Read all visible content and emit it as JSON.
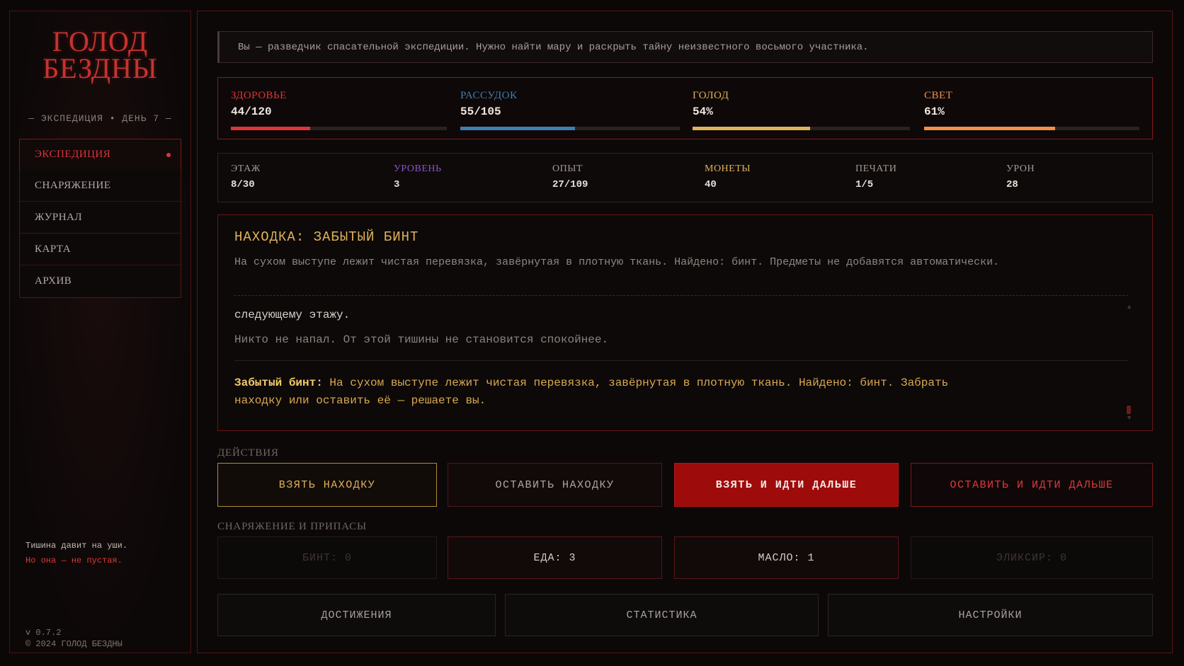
{
  "sidebar": {
    "title_line1": "ГОЛОД",
    "title_line2": "БЕЗДНЫ",
    "day_line": "— ЭКСПЕДИЦИЯ • ДЕНЬ 7 —",
    "nav": [
      {
        "label": "ЭКСПЕДИЦИЯ",
        "active": true
      },
      {
        "label": "СНАРЯЖЕНИЕ"
      },
      {
        "label": "ЖУРНАЛ"
      },
      {
        "label": "КАРТА"
      },
      {
        "label": "АРХИВ"
      }
    ],
    "flavor_line1": "Тишина давит на уши.",
    "flavor_line2": "Но она — не пустая.",
    "version": "v 0.7.2",
    "copyright": "© 2024 ГОЛОД БЕЗДНЫ"
  },
  "intro": "Вы — разведчик спасательной экспедиции. Нужно найти мару и раскрыть тайну неизвестного восьмого участника.",
  "vitals": [
    {
      "label": "ЗДОРОВЬЕ",
      "value": "44/120",
      "fraction": 0.367,
      "color": "#e0343a"
    },
    {
      "label": "РАССУДОК",
      "value": "55/105",
      "fraction": 0.524,
      "color": "#3e7fb0"
    },
    {
      "label": "ГОЛОД",
      "value": "54%",
      "fraction": 0.54,
      "color": "#e0b25a"
    },
    {
      "label": "СВЕТ",
      "value": "61%",
      "fraction": 0.61,
      "color": "#f0904a"
    }
  ],
  "stats": [
    {
      "label": "ЭТАЖ",
      "value": "8/30",
      "color": "#a39890"
    },
    {
      "label": "УРОВЕНЬ",
      "value": "3",
      "color": "#8a55c8"
    },
    {
      "label": "ОПЫТ",
      "value": "27/109",
      "color": "#a39890"
    },
    {
      "label": "МОНЕТЫ",
      "value": "40",
      "color": "#e0b25a"
    },
    {
      "label": "ПЕЧАТИ",
      "value": "1/5",
      "color": "#a39890"
    },
    {
      "label": "УРОН",
      "value": "28",
      "color": "#a39890"
    }
  ],
  "event": {
    "title": "НАХОДКА: ЗАБЫТЫЙ БИНТ",
    "description": "На сухом выступе лежит чистая перевязка, завёрнутая в плотную ткань. Найдено: бинт. Предметы не добавятся автоматически.",
    "log_line1": "следующему этажу.",
    "log_line2": "Никто не напал. От этой тишины не становится спокойнее.",
    "log_item_name": "Забытый бинт:",
    "log_item_text": " На сухом выступе лежит чистая перевязка, завёрнутая в плотную ткань. Найдено: бинт. Забрать находку или оставить её — решаете вы."
  },
  "actions": {
    "section_label": "ДЕЙСТВИЯ",
    "take": "ВЗЯТЬ НАХОДКУ",
    "leave": "ОСТАВИТЬ НАХОДКУ",
    "take_and_go": "ВЗЯТЬ И ИДТИ ДАЛЬШЕ",
    "leave_and_go": "ОСТАВИТЬ И ИДТИ ДАЛЬШЕ"
  },
  "supplies": {
    "section_label": "СНАРЯЖЕНИЕ И ПРИПАСЫ",
    "bandage": "БИНТ: 0",
    "food": "ЕДА: 3",
    "oil": "МАСЛО: 1",
    "elixir": "ЭЛИКСИР: 0"
  },
  "footer": {
    "achievements": "ДОСТИЖЕНИЯ",
    "statistics": "СТАТИСТИКА",
    "settings": "НАСТРОЙКИ"
  }
}
